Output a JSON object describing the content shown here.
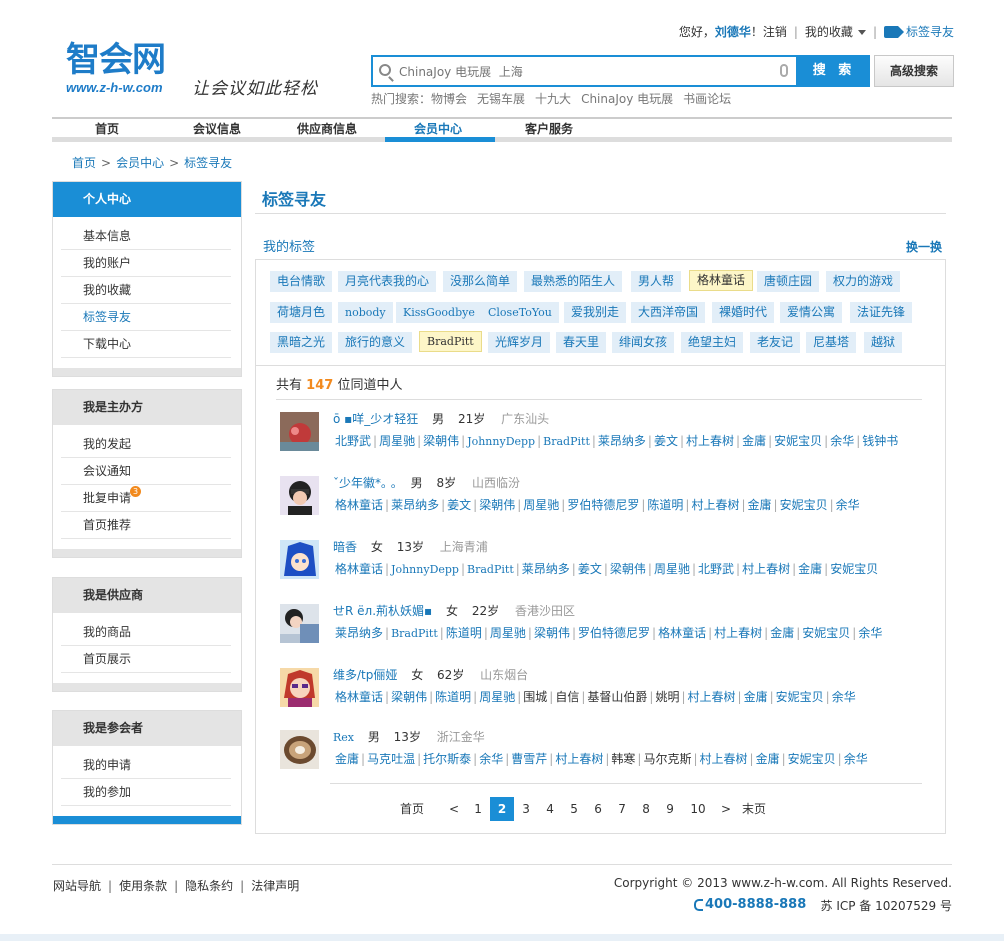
{
  "brand": {
    "logo_text": "智会网",
    "url": "www.z-h-w.com",
    "slogan": "让会议如此轻松"
  },
  "topbar": {
    "greeting": "您好，",
    "username": "刘德华",
    "greeting_end": "！",
    "logout": "注销",
    "favorites": "我的收藏",
    "tag_friends": "标签寻友"
  },
  "search": {
    "placeholder": "ChinaJoy 电玩展  上海",
    "button": "搜 索",
    "advanced": "高级搜索",
    "hot_label": "热门搜索：",
    "hot_items": [
      "物博会",
      "无锡车展",
      "十九大",
      "ChinaJoy 电玩展",
      "书画论坛"
    ]
  },
  "nav": [
    "首页",
    "会议信息",
    "供应商信息",
    "会员中心",
    "客户服务"
  ],
  "breadcrumb": [
    "首页",
    "会员中心",
    "标签寻友"
  ],
  "sidebar": {
    "personal": {
      "title": "个人中心",
      "items": [
        "基本信息",
        "我的账户",
        "我的收藏",
        "标签寻友",
        "下载中心"
      ]
    },
    "organizer": {
      "title": "我是主办方",
      "items": [
        "我的发起",
        "会议通知",
        "批复申请",
        "首页推荐"
      ],
      "badge": "3"
    },
    "supplier": {
      "title": "我是供应商",
      "items": [
        "我的商品",
        "首页展示"
      ]
    },
    "attendee": {
      "title": "我是参会者",
      "items": [
        "我的申请",
        "我的参加"
      ]
    }
  },
  "main": {
    "title": "标签寻友",
    "my_tags_label": "我的标签",
    "swap": "换一换",
    "tags": [
      "电台情歌",
      "月亮代表我的心",
      "没那么简单",
      "最熟悉的陌生人",
      "男人帮",
      "格林童话",
      "唐顿庄园",
      "权力的游戏",
      "荷塘月色",
      "nobody",
      "KissGoodbye",
      "CloseToYou",
      "爱我别走",
      "大西洋帝国",
      "裸婚时代",
      "爱情公寓",
      "法证先锋",
      "黑暗之光",
      "旅行的意义",
      "BradPitt",
      "光辉岁月",
      "春天里",
      "绯闻女孩",
      "绝望主妇",
      "老友记",
      "尼基塔",
      "越狱"
    ],
    "count_prefix": "共有",
    "count": "147",
    "count_suffix": "位同道中人"
  },
  "people": [
    {
      "name": "ō ▪咩_少オ轻狂",
      "gender": "男",
      "age": "21岁",
      "location": "广东汕头",
      "tags": [
        "北野武",
        "周星驰",
        "梁朝伟",
        "JohnnyDepp",
        "BradPitt",
        "莱昂纳多",
        "姜文",
        "村上春树",
        "金庸",
        "安妮宝贝",
        "余华",
        "钱钟书"
      ]
    },
    {
      "name": "ˇ少年徽*｡ ｡",
      "gender": "男",
      "age": "8岁",
      "location": "山西临汾",
      "tags": [
        "格林童话",
        "莱昂纳多",
        "姜文",
        "梁朝伟",
        "周星驰",
        "罗伯特德尼罗",
        "陈道明",
        "村上春树",
        "金庸",
        "安妮宝贝",
        "余华"
      ]
    },
    {
      "name": "暗香",
      "gender": "女",
      "age": "13岁",
      "location": "上海青浦",
      "tags": [
        "格林童话",
        "JohnnyDepp",
        "BradPitt",
        "莱昂纳多",
        "姜文",
        "梁朝伟",
        "周星驰",
        "北野武",
        "村上春树",
        "金庸",
        "安妮宝贝"
      ]
    },
    {
      "name": "せR ёл.荊朲妖媚▪",
      "gender": "女",
      "age": "22岁",
      "location": "香港沙田区",
      "tags": [
        "莱昂纳多",
        "BradPitt",
        "陈道明",
        "周星驰",
        "梁朝伟",
        "罗伯特德尼罗",
        "格林童话",
        "村上春树",
        "金庸",
        "安妮宝贝",
        "余华"
      ]
    },
    {
      "name": "维多/tp俪娅",
      "gender": "女",
      "age": "62岁",
      "location": "山东烟台",
      "tags": [
        "格林童话",
        "梁朝伟",
        "陈道明",
        "周星驰",
        "围城",
        "自信",
        "基督山伯爵",
        "姚明",
        "村上春树",
        "金庸",
        "安妮宝贝",
        "余华"
      ]
    },
    {
      "name": "Rex",
      "gender": "男",
      "age": "13岁",
      "location": "浙江金华",
      "tags": [
        "金庸",
        "马克吐温",
        "托尔斯泰",
        "余华",
        "曹雪芹",
        "村上春树",
        "韩寒",
        "马尔克斯",
        "村上春树",
        "金庸",
        "安妮宝贝",
        "余华"
      ]
    }
  ],
  "pager": {
    "first": "首页",
    "prev": "<",
    "pages": [
      "1",
      "2",
      "3",
      "4",
      "5",
      "6",
      "7",
      "8",
      "9",
      "10"
    ],
    "current": "2",
    "next": ">",
    "last": "末页"
  },
  "footer": {
    "links": [
      "网站导航",
      "使用条款",
      "隐私条约",
      "法律声明"
    ],
    "copyright": "Corpyright © 2013 www.z-h-w.com. All Rights Reserved.",
    "phone": "400-8888-888",
    "icp": "苏 ICP 备 10207529 号"
  },
  "colors": {
    "accent": "#1a8ed6",
    "link": "#1a78b8",
    "highlight": "#f28a1e"
  }
}
